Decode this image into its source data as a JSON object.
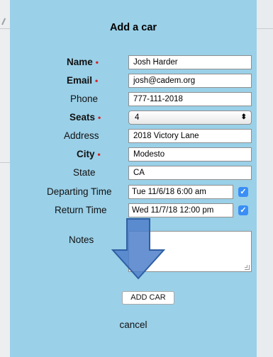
{
  "modal": {
    "title": "Add a car",
    "required_marker": "•"
  },
  "form": {
    "name": {
      "label": "Name",
      "value": "Josh Harder",
      "required": true
    },
    "email": {
      "label": "Email",
      "value": "josh@cadem.org",
      "required": true
    },
    "phone": {
      "label": "Phone",
      "value": "777-111-2018",
      "required": false
    },
    "seats": {
      "label": "Seats",
      "value": "4",
      "required": true
    },
    "address": {
      "label": "Address",
      "value": "2018 Victory Lane",
      "required": false
    },
    "city": {
      "label": "City",
      "value": "Modesto",
      "required": true
    },
    "state": {
      "label": "State",
      "value": "CA",
      "required": false
    },
    "departing_time": {
      "label": "Departing Time",
      "value": "Tue 11/6/18 6:00 am",
      "checked": true
    },
    "return_time": {
      "label": "Return Time",
      "value": "Wed 11/7/18 12:00 pm",
      "checked": true
    },
    "notes": {
      "label": "Notes",
      "value": ""
    }
  },
  "actions": {
    "add_car": "ADD CAR",
    "cancel": "cancel"
  },
  "icons": {
    "checkbox": "checkmark-icon",
    "select": "updown-chevron-icon",
    "annotation": "down-arrow-icon"
  },
  "colors": {
    "modal_background": "#9ad0e8",
    "required_star": "#d32424",
    "checkbox": "#3a8ef5",
    "arrow": "#4d7fc9"
  }
}
